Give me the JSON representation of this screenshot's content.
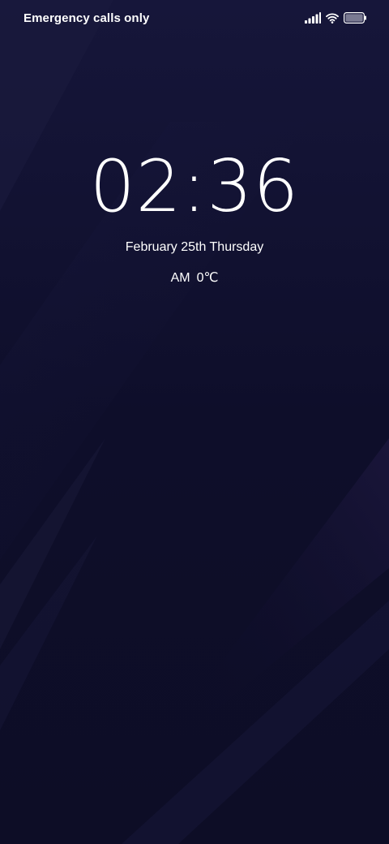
{
  "status_bar": {
    "carrier": "Emergency calls only",
    "icons": [
      "signal-icon",
      "wifi-icon",
      "battery-icon"
    ]
  },
  "lockscreen": {
    "time": "02:36",
    "date": "February 25th Thursday",
    "meridiem": "AM",
    "temperature": "0℃"
  },
  "colors": {
    "background": "#0f0f2a",
    "text": "#ffffff"
  }
}
